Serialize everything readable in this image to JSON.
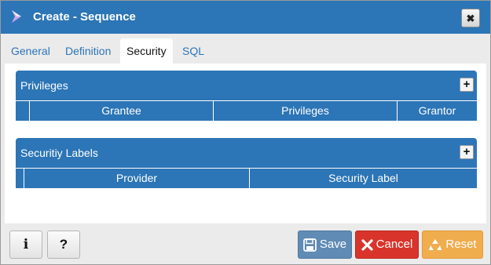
{
  "dialog": {
    "title": "Create - Sequence",
    "close_glyph": "✖",
    "icons": {
      "logo": "sequence-icon",
      "close": "close-icon"
    }
  },
  "tabs": [
    {
      "label": "General",
      "active": false
    },
    {
      "label": "Definition",
      "active": false
    },
    {
      "label": "Security",
      "active": true
    },
    {
      "label": "SQL",
      "active": false
    }
  ],
  "privileges": {
    "title": "Privileges",
    "add_glyph": "+",
    "columns": [
      "Grantee",
      "Privileges",
      "Grantor"
    ],
    "rows": []
  },
  "security_labels": {
    "title": "Securitiy Labels",
    "add_glyph": "+",
    "columns": [
      "Provider",
      "Security Label"
    ],
    "rows": []
  },
  "footer": {
    "info_glyph": "i",
    "help_glyph": "?",
    "save_label": "Save",
    "cancel_label": "Cancel",
    "reset_label": "Reset",
    "colors": {
      "save": "#5f8bb4",
      "cancel": "#d9342b",
      "reset": "#f0ad4e"
    }
  },
  "colors": {
    "accent": "#2c75b6",
    "background": "#ebebeb"
  }
}
